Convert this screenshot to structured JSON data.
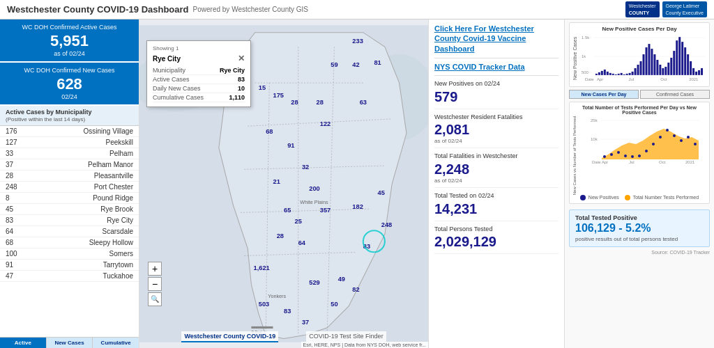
{
  "header": {
    "title": "Westchester County COVID-19 Dashboard",
    "subtitle": "Powered by Westchester County GIS",
    "logo1": "Westchester\nCOUNTY",
    "logo2": "George Latimer\nCounty Executive"
  },
  "left": {
    "confirmed_active_label": "WC DOH Confirmed Active Cases",
    "confirmed_active_value": "5,951",
    "confirmed_active_date": "as of 02/24",
    "confirmed_new_label": "WC DOH Confirmed New Cases",
    "confirmed_new_value": "628",
    "confirmed_new_date": "02/24",
    "municipality_title": "Active Cases by Municipality",
    "municipality_subtitle": "(Positive within the last 14 days)",
    "items": [
      {
        "name": "Ossining Village",
        "count": "176"
      },
      {
        "name": "Peekskill",
        "count": "127"
      },
      {
        "name": "Pelham",
        "count": "33"
      },
      {
        "name": "Pelham Manor",
        "count": "37"
      },
      {
        "name": "Pleasantville",
        "count": "28"
      },
      {
        "name": "Port Chester",
        "count": "248"
      },
      {
        "name": "Pound Ridge",
        "count": "8"
      },
      {
        "name": "Rye Brook",
        "count": "45"
      },
      {
        "name": "Rye City",
        "count": "83"
      },
      {
        "name": "Scarsdale",
        "count": "64"
      },
      {
        "name": "Sleepy Hollow",
        "count": "68"
      },
      {
        "name": "Somers",
        "count": "100"
      },
      {
        "name": "Tarrytown",
        "count": "91"
      },
      {
        "name": "Tuckahoe",
        "count": "47"
      }
    ],
    "tabs": [
      "Active",
      "New Cases",
      "Cumulative"
    ]
  },
  "popup": {
    "showing": "Showing 1",
    "municipality_label": "Municipality",
    "municipality_value": "Rye City",
    "active_label": "Active Cases",
    "active_value": "83",
    "daily_label": "Daily New Cases",
    "daily_value": "10",
    "cumulative_label": "Cumulative Cases",
    "cumulative_value": "1,110"
  },
  "map": {
    "labels": [
      "Westchester County COVID-19",
      "COVID-19 Test Site Finder"
    ],
    "attribution": "Esri, HERE, NPS | Data from NYS DOH, web service fr...",
    "numbers": [
      "233",
      "81",
      "42",
      "59",
      "15",
      "175",
      "28",
      "28",
      "63",
      "122",
      "68",
      "91",
      "32",
      "21",
      "200",
      "357",
      "182",
      "45",
      "248",
      "83",
      "65",
      "25",
      "28",
      "64",
      "1,621",
      "529",
      "49",
      "82",
      "50",
      "503",
      "83",
      "37"
    ]
  },
  "right_stats": {
    "vaccine_link": "Click Here For Westchester County Covid-19 Vaccine Dashboard",
    "nys_link": "NYS COVID Tracker Data",
    "new_positives_label": "New Positives on 02/24",
    "new_positives_value": "579",
    "fatalities_resident_label": "Westchester Resident Fatalities",
    "fatalities_resident_value": "2,081",
    "fatalities_resident_date": "as of 02/24",
    "fatalities_total_label": "Total Fatalities in Westchester",
    "fatalities_total_value": "2,248",
    "fatalities_total_date": "as of 02/24",
    "tested_label": "Total Tested on 02/24",
    "tested_value": "14,231",
    "persons_tested_label": "Total Persons Tested",
    "persons_tested_value": "2,029,129"
  },
  "charts": {
    "chart1_title": "New Positive Cases Per Day",
    "chart1_y_max": "1.5k",
    "chart1_y_mid": "1k",
    "chart1_y_low": "500",
    "chart1_x_labels": [
      "Apr",
      "Jul",
      "Oct",
      "2021"
    ],
    "chart2_title": "Total Number of Tests Performed Per Day vs New Positive Cases",
    "chart2_y_max": "25k",
    "chart2_y_mid": "10k",
    "chart2_x_labels": [
      "Apr",
      "Jul",
      "Oct",
      "2021"
    ],
    "tab1": "New Cases Per Day",
    "tab2": "Confirmed Cases",
    "legend_new": "New Positives",
    "legend_tests": "Total Number Tests Performed",
    "total_tested_label": "Total Tested Positive",
    "total_tested_value": "106,129 - 5.2%",
    "total_tested_sub": "positive results out of total persons tested",
    "source": "Source: COVID-19 Tracker"
  }
}
